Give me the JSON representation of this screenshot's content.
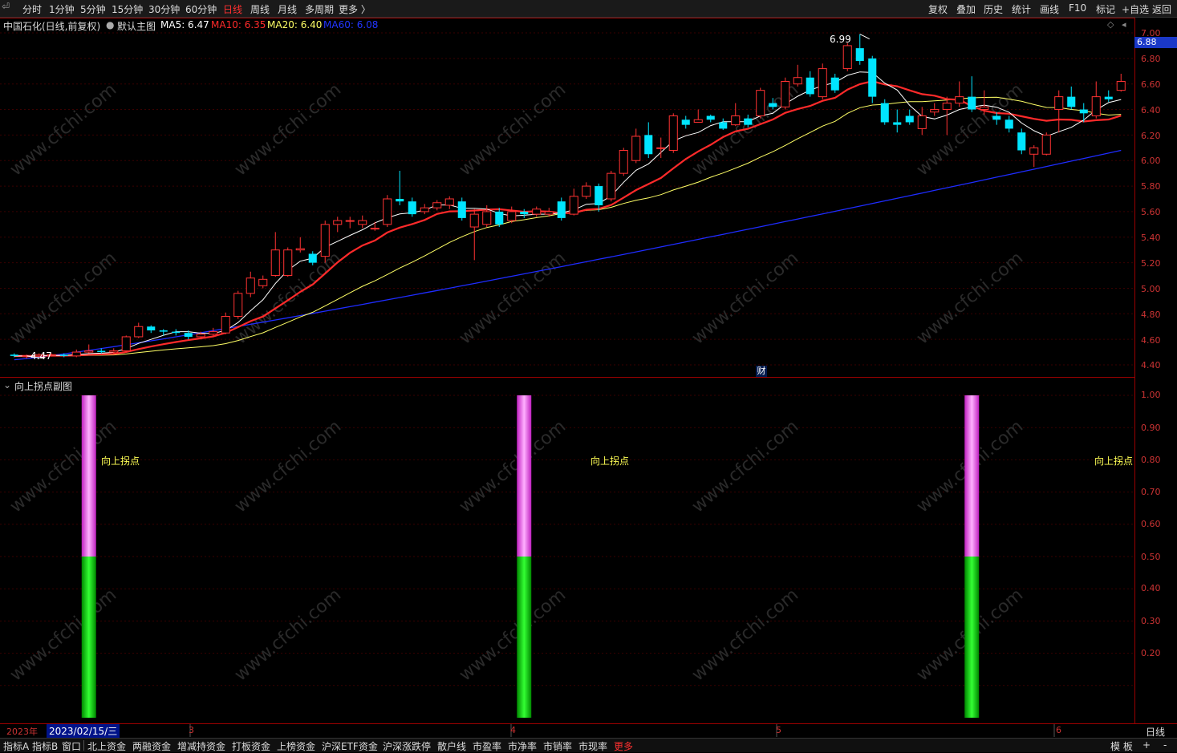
{
  "topbar": {
    "back_icon": "back-arrow-icon",
    "tabs": [
      "分时",
      "1分钟",
      "5分钟",
      "15分钟",
      "30分钟",
      "60分钟",
      "日线",
      "周线",
      "月线",
      "多周期",
      "更多 〉"
    ],
    "active_tab": "日线",
    "right": [
      "复权",
      "叠加",
      "历史",
      "统计",
      "画线",
      "F10",
      "标记",
      "+自选",
      "返回"
    ]
  },
  "main": {
    "stock": "中国石化(日线,前复权)",
    "template": "默认主图",
    "ma5": "MA5: 6.47",
    "ma10": "MA10: 6.35",
    "ma20": "MA20: 6.40",
    "ma60": "MA60: 6.08",
    "high_mark": "6.99",
    "low_mark": "4.47",
    "cai_mark": "财",
    "current_price": "6.88",
    "y_ticks": [
      "7.00",
      "6.80",
      "6.60",
      "6.40",
      "6.20",
      "6.00",
      "5.80",
      "5.60",
      "5.40",
      "5.20",
      "5.00",
      "4.80",
      "4.60",
      "4.40"
    ]
  },
  "sub": {
    "title": "向上拐点副图",
    "label": "向上拐点",
    "y_ticks": [
      "1.00",
      "0.90",
      "0.80",
      "0.70",
      "0.60",
      "0.50",
      "0.40",
      "0.30",
      "0.20"
    ]
  },
  "xaxis": {
    "year": "2023年",
    "date": "2023/02/15/三",
    "months": [
      "3",
      "4",
      "5",
      "6"
    ],
    "period": "日线"
  },
  "bottombar": {
    "items": [
      "指标A",
      "指标B",
      "窗口",
      "北上资金",
      "两融资金",
      "增减持资金",
      "打板资金",
      "上榜资金",
      "沪深ETF资金",
      "沪深涨跌停",
      "散户线",
      "市盈率",
      "市净率",
      "市销率",
      "市现率",
      "更多"
    ],
    "right": [
      "模 板",
      "+",
      "-"
    ]
  },
  "watermark": "www.cfchi.com",
  "colors": {
    "up": "#ff3232",
    "down": "#00e5ff",
    "ma5": "#ffffff",
    "ma10": "#ff2a2a",
    "ma20": "#ffff66",
    "ma60": "#1e2cff",
    "pink": "#ff66ff",
    "green": "#00dd00"
  },
  "chart_data": {
    "type": "candlestick",
    "ylim": [
      4.4,
      7.0
    ],
    "candles": [
      [
        4.48,
        4.47,
        4.49,
        4.46
      ],
      [
        4.47,
        4.47,
        4.48,
        4.45
      ],
      [
        4.47,
        4.48,
        4.49,
        4.46
      ],
      [
        4.48,
        4.48,
        4.49,
        4.47
      ],
      [
        4.48,
        4.47,
        4.49,
        4.46
      ],
      [
        4.47,
        4.5,
        4.52,
        4.46
      ],
      [
        4.5,
        4.51,
        4.56,
        4.49
      ],
      [
        4.51,
        4.5,
        4.53,
        4.49
      ],
      [
        4.5,
        4.51,
        4.53,
        4.49
      ],
      [
        4.51,
        4.62,
        4.63,
        4.5
      ],
      [
        4.62,
        4.7,
        4.73,
        4.61
      ],
      [
        4.7,
        4.67,
        4.71,
        4.65
      ],
      [
        4.67,
        4.66,
        4.68,
        4.63
      ],
      [
        4.66,
        4.65,
        4.68,
        4.63
      ],
      [
        4.65,
        4.62,
        4.67,
        4.6
      ],
      [
        4.62,
        4.64,
        4.66,
        4.6
      ],
      [
        4.64,
        4.66,
        4.69,
        4.62
      ],
      [
        4.65,
        4.78,
        4.81,
        4.64
      ],
      [
        4.78,
        4.96,
        4.98,
        4.76
      ],
      [
        4.96,
        5.08,
        5.13,
        4.93
      ],
      [
        5.02,
        5.07,
        5.1,
        5.0
      ],
      [
        5.1,
        5.3,
        5.44,
        5.09
      ],
      [
        5.1,
        5.3,
        5.32,
        5.09
      ],
      [
        5.3,
        5.31,
        5.4,
        5.28
      ],
      [
        5.27,
        5.2,
        5.29,
        5.18
      ],
      [
        5.25,
        5.5,
        5.53,
        5.2
      ],
      [
        5.5,
        5.53,
        5.56,
        5.44
      ],
      [
        5.53,
        5.53,
        5.56,
        5.47
      ],
      [
        5.5,
        5.53,
        5.57,
        5.47
      ],
      [
        5.47,
        5.47,
        5.52,
        5.45
      ],
      [
        5.5,
        5.7,
        5.73,
        5.48
      ],
      [
        5.7,
        5.68,
        5.92,
        5.65
      ],
      [
        5.68,
        5.58,
        5.71,
        5.56
      ],
      [
        5.6,
        5.63,
        5.66,
        5.58
      ],
      [
        5.63,
        5.67,
        5.69,
        5.61
      ],
      [
        5.65,
        5.7,
        5.72,
        5.62
      ],
      [
        5.68,
        5.55,
        5.71,
        5.53
      ],
      [
        5.48,
        5.58,
        5.62,
        5.22
      ],
      [
        5.5,
        5.6,
        5.65,
        5.48
      ],
      [
        5.6,
        5.5,
        5.63,
        5.48
      ],
      [
        5.53,
        5.6,
        5.64,
        5.51
      ],
      [
        5.6,
        5.58,
        5.62,
        5.55
      ],
      [
        5.58,
        5.62,
        5.64,
        5.56
      ],
      [
        5.58,
        5.6,
        5.63,
        5.56
      ],
      [
        5.68,
        5.55,
        5.71,
        5.53
      ],
      [
        5.58,
        5.72,
        5.78,
        5.57
      ],
      [
        5.72,
        5.8,
        5.83,
        5.7
      ],
      [
        5.8,
        5.65,
        5.82,
        5.6
      ],
      [
        5.7,
        5.9,
        5.92,
        5.68
      ],
      [
        5.9,
        6.08,
        6.1,
        5.88
      ],
      [
        6.0,
        6.19,
        6.25,
        5.98
      ],
      [
        6.2,
        6.05,
        6.3,
        6.02
      ],
      [
        6.1,
        6.1,
        6.18,
        6.02
      ],
      [
        6.08,
        6.35,
        6.37,
        6.06
      ],
      [
        6.32,
        6.28,
        6.35,
        6.25
      ],
      [
        6.3,
        6.32,
        6.4,
        6.3
      ],
      [
        6.35,
        6.32,
        6.36,
        6.3
      ],
      [
        6.3,
        6.25,
        6.33,
        6.24
      ],
      [
        6.28,
        6.35,
        6.45,
        6.27
      ],
      [
        6.33,
        6.28,
        6.36,
        6.26
      ],
      [
        6.35,
        6.55,
        6.57,
        6.33
      ],
      [
        6.45,
        6.42,
        6.49,
        6.4
      ],
      [
        6.42,
        6.62,
        6.65,
        6.4
      ],
      [
        6.6,
        6.65,
        6.75,
        6.58
      ],
      [
        6.65,
        6.52,
        6.7,
        6.5
      ],
      [
        6.5,
        6.72,
        6.76,
        6.48
      ],
      [
        6.65,
        6.55,
        6.68,
        6.53
      ],
      [
        6.72,
        6.9,
        6.92,
        6.7
      ],
      [
        6.88,
        6.78,
        6.99,
        6.75
      ],
      [
        6.8,
        6.5,
        6.82,
        6.45
      ],
      [
        6.45,
        6.3,
        6.48,
        6.28
      ],
      [
        6.3,
        6.28,
        6.4,
        6.22
      ],
      [
        6.35,
        6.3,
        6.4,
        6.28
      ],
      [
        6.25,
        6.35,
        6.42,
        6.2
      ],
      [
        6.38,
        6.4,
        6.45,
        6.35
      ],
      [
        6.4,
        6.45,
        6.5,
        6.2
      ],
      [
        6.45,
        6.5,
        6.62,
        6.42
      ],
      [
        6.5,
        6.4,
        6.66,
        6.38
      ],
      [
        6.4,
        6.42,
        6.55,
        6.36
      ],
      [
        6.35,
        6.32,
        6.38,
        6.28
      ],
      [
        6.32,
        6.25,
        6.35,
        6.22
      ],
      [
        6.22,
        6.08,
        6.25,
        6.05
      ],
      [
        6.05,
        6.1,
        6.12,
        5.95
      ],
      [
        6.05,
        6.2,
        6.22,
        6.04
      ],
      [
        6.4,
        6.5,
        6.55,
        6.22
      ],
      [
        6.5,
        6.42,
        6.58,
        6.4
      ],
      [
        6.4,
        6.37,
        6.45,
        6.3
      ],
      [
        6.35,
        6.5,
        6.62,
        6.33
      ],
      [
        6.5,
        6.48,
        6.55,
        6.46
      ],
      [
        6.55,
        6.62,
        6.68,
        6.54
      ]
    ],
    "ma5_last": 6.47,
    "ma10_last": 6.35,
    "ma20_last": 6.4,
    "ma60_last": 6.08,
    "signal_days": [
      6,
      41,
      77
    ],
    "sub_ylim": [
      0,
      1.0
    ]
  }
}
